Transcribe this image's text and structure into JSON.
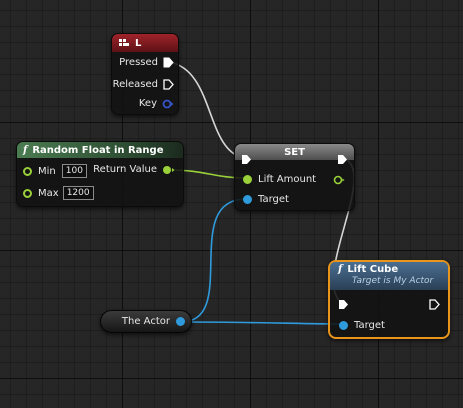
{
  "colors": {
    "input_event_header": "#8a1a1f",
    "function_header": "#3f6f47",
    "set_header": "#6b6b6b",
    "lift_cube_header": "#34506b",
    "selected_outline": "#e8951a",
    "exec_wire": "#d8d8d8",
    "float_pin": "#9ad13a",
    "object_pin": "#2f9bdc",
    "key_pin": "#3454c8"
  },
  "input_node": {
    "title": "L",
    "icon": "keyboard-icon",
    "pins": {
      "pressed": "Pressed",
      "released": "Released",
      "key": "Key"
    }
  },
  "random_node": {
    "title": "Random Float in Range",
    "icon": "function-icon",
    "min_label": "Min",
    "min_value": "100",
    "max_label": "Max",
    "max_value": "1200",
    "return_label": "Return Value"
  },
  "set_node": {
    "title": "SET",
    "lift_amount_label": "Lift Amount",
    "target_label": "Target"
  },
  "lift_node": {
    "title": "Lift Cube",
    "subtitle": "Target is My Actor",
    "icon": "function-icon",
    "target_label": "Target"
  },
  "actor_node": {
    "label": "The Actor"
  }
}
